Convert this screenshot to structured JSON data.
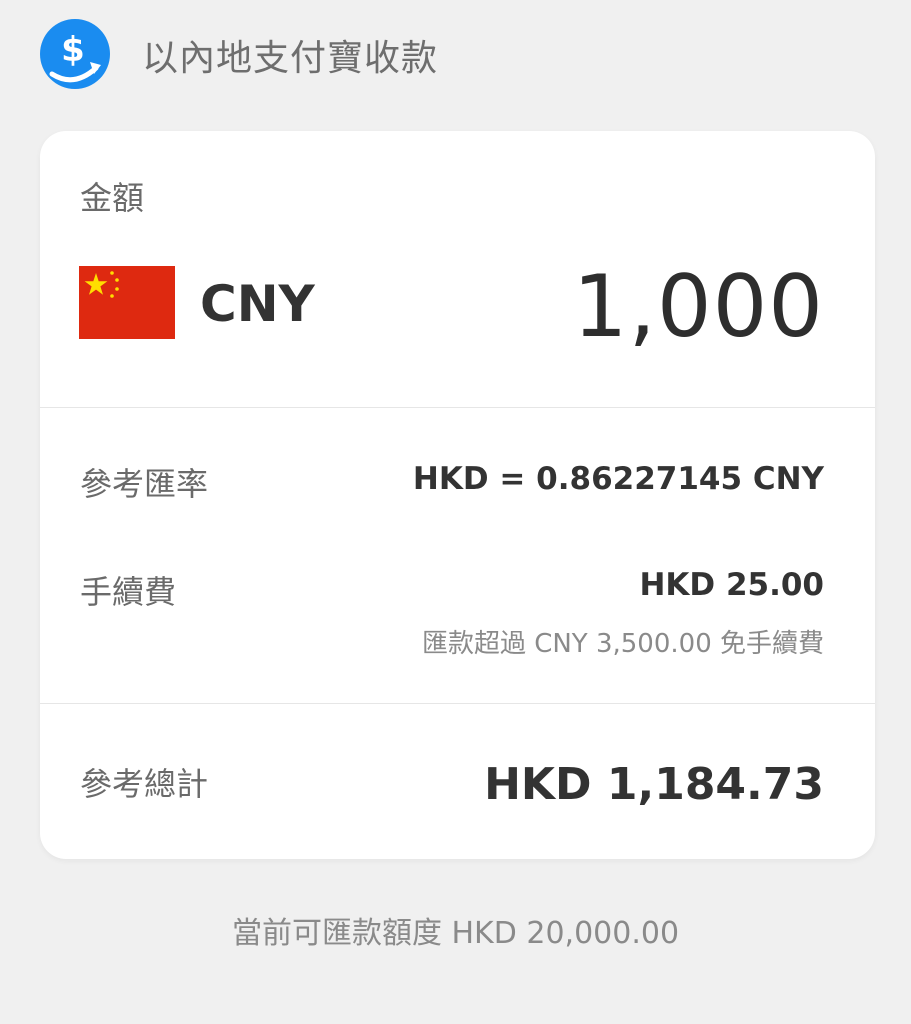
{
  "header": {
    "title": "以內地支付寶收款",
    "icon": "dollar-transfer-icon",
    "icon_color": "#1a8cf0"
  },
  "amount_section": {
    "label": "金額",
    "currency_icon": "china-flag-icon",
    "currency_code": "CNY",
    "amount": "1,000"
  },
  "details": {
    "rate_label": "參考匯率",
    "rate_value": "HKD = 0.86227145 CNY",
    "fee_label": "手續費",
    "fee_value": "HKD 25.00",
    "fee_note": "匯款超過 CNY 3,500.00 免手續費"
  },
  "total": {
    "label": "參考總計",
    "value": "HKD 1,184.73"
  },
  "footer": {
    "limit_text": "當前可匯款額度 HKD 20,000.00"
  },
  "colors": {
    "background": "#f0f0f0",
    "card": "#ffffff",
    "flag_red": "#de2910",
    "flag_yellow": "#ffde00"
  }
}
